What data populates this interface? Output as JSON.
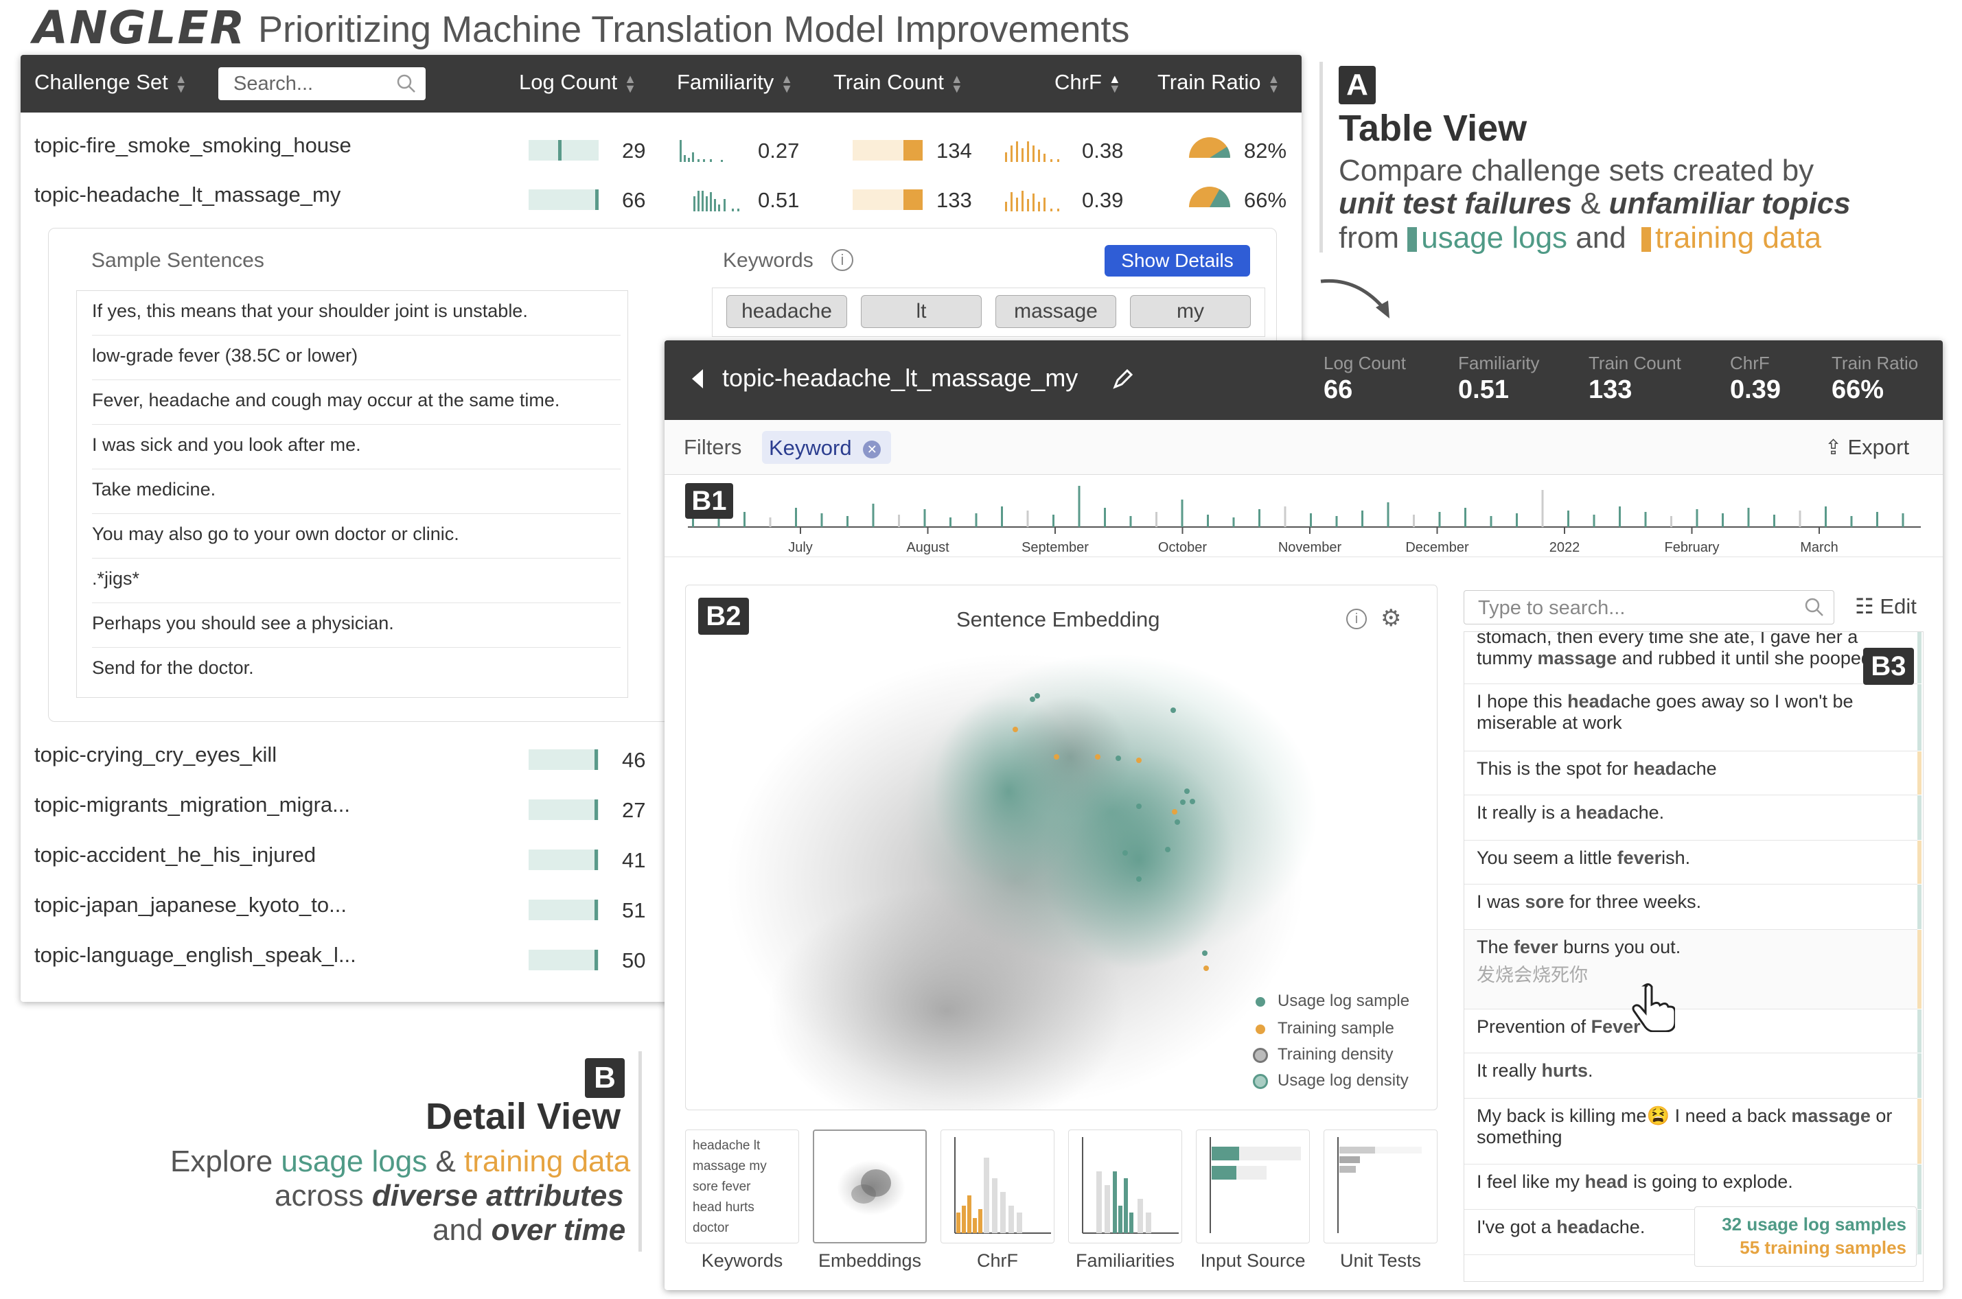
{
  "title": {
    "logo": "ANGLER",
    "subtitle": "Prioritizing Machine Translation Model Improvements"
  },
  "table": {
    "headers": {
      "challenge_set": "Challenge Set",
      "search_placeholder": "Search...",
      "log_count": "Log Count",
      "familiarity": "Familiarity",
      "train_count": "Train Count",
      "chrf": "ChrF",
      "train_ratio": "Train Ratio"
    },
    "rows": [
      {
        "name": "topic-fire_smoke_smoking_house",
        "log_count": "29",
        "log_frac": 0.44,
        "familiarity": "0.27",
        "train_count": "134",
        "chrf": "0.38",
        "train_ratio": "82%",
        "ratio_frac": 0.82
      },
      {
        "name": "topic-headache_lt_massage_my",
        "log_count": "66",
        "log_frac": 1.0,
        "familiarity": "0.51",
        "train_count": "133",
        "chrf": "0.39",
        "train_ratio": "66%",
        "ratio_frac": 0.66
      }
    ],
    "more_rows": [
      {
        "name": "topic-crying_cry_eyes_kill",
        "log_count": "46"
      },
      {
        "name": "topic-migrants_migration_migra...",
        "log_count": "27"
      },
      {
        "name": "topic-accident_he_his_injured",
        "log_count": "41"
      },
      {
        "name": "topic-japan_japanese_kyoto_to...",
        "log_count": "51"
      },
      {
        "name": "topic-language_english_speak_l...",
        "log_count": "50"
      }
    ],
    "expanded": {
      "sample_label": "Sample Sentences",
      "sentences": [
        "If yes, this means that your shoulder joint is unstable.",
        "low-grade fever (38.5C or lower)",
        "Fever, headache and cough may occur at the same time.",
        "I was sick and you look after me.",
        "Take medicine.",
        "You may also go to your own doctor or clinic.",
        ".*jigs*",
        "Perhaps you should see a physician.",
        "Send for the doctor."
      ],
      "keywords_label": "Keywords",
      "show_details": "Show Details",
      "keywords": [
        "headache",
        "lt",
        "massage",
        "my"
      ]
    }
  },
  "annotation_a": {
    "badge": "A",
    "title": "Table View",
    "line1": "Compare challenge sets created by",
    "line2a": "unit test failures",
    "line2b": " & ",
    "line2c": "unfamiliar topics",
    "line3a": "from ",
    "line3b": "usage logs",
    "line3c": " and ",
    "line3d": "training data"
  },
  "annotation_b": {
    "badge": "B",
    "title": "Detail View",
    "line1a": "Explore ",
    "line1b": "usage logs",
    "line1c": " & ",
    "line1d": "training data",
    "line2a": "across ",
    "line2b": "diverse attributes",
    "line3a": "and ",
    "line3b": "over time"
  },
  "detail": {
    "title": "topic-headache_lt_massage_my",
    "stats": [
      {
        "label": "Log Count",
        "value": "66"
      },
      {
        "label": "Familiarity",
        "value": "0.51"
      },
      {
        "label": "Train Count",
        "value": "133"
      },
      {
        "label": "ChrF",
        "value": "0.39"
      },
      {
        "label": "Train Ratio",
        "value": "66%"
      }
    ],
    "filters_label": "Filters",
    "filter_chip": "Keyword",
    "export": "Export",
    "timeline": {
      "badge": "B1",
      "months": [
        "July",
        "August",
        "September",
        "October",
        "November",
        "December",
        "2022",
        "February",
        "March"
      ]
    },
    "embedding": {
      "badge": "B2",
      "title": "Sentence Embedding",
      "legend": [
        "Usage log sample",
        "Training sample",
        "Training density",
        "Usage log density"
      ]
    },
    "thumbs": {
      "labels": [
        "Keywords",
        "Embeddings",
        "ChrF",
        "Familiarities",
        "Input Source",
        "Unit Tests"
      ],
      "keyword_words": [
        "headache",
        "lt",
        "massage",
        "my",
        "sore",
        "fever",
        "head",
        "hurts",
        "doctor"
      ]
    },
    "list": {
      "badge": "B3",
      "search_placeholder": "Type to search...",
      "edit": "Edit",
      "items": [
        {
          "pre": "stomach, then every time she ate, I gave her a tummy ",
          "kw": "massage",
          "post": " and rubbed it until she pooped.",
          "type": "usage"
        },
        {
          "pre": "I hope this ",
          "kw": "head",
          "post": "ache goes away so I won't be miserable at work",
          "type": "usage"
        },
        {
          "pre": "This is the spot for ",
          "kw": "head",
          "post": "ache",
          "type": "training"
        },
        {
          "pre": "It really is a ",
          "kw": "head",
          "post": "ache.",
          "type": "usage"
        },
        {
          "pre": "You seem a little ",
          "kw": "fever",
          "post": "ish.",
          "type": "training"
        },
        {
          "pre": "I was ",
          "kw": "sore",
          "post": " for three weeks.",
          "type": "usage"
        },
        {
          "pre": "The ",
          "kw": "fever",
          "post": " burns you out.",
          "type": "training",
          "translation": "发烧会烧死你"
        },
        {
          "pre": "Prevention of ",
          "kw": "Fever",
          "post": "",
          "type": "usage"
        },
        {
          "pre": "It really ",
          "kw": "hurts",
          "post": ".",
          "type": "usage"
        },
        {
          "pre": "My back is killing me😫 I need a back ",
          "kw": "massage",
          "post": " or something",
          "type": "training"
        },
        {
          "pre": "I feel like my ",
          "kw": "head",
          "post": " is going to explode.",
          "type": "usage"
        },
        {
          "pre": "I've got a ",
          "kw": "head",
          "post": "ache.",
          "type": "usage"
        }
      ],
      "usage_count": "32 usage log samples",
      "training_count": "55 training samples"
    }
  },
  "colors": {
    "usage": "#5a9a8a",
    "training": "#e6a340",
    "header": "#3a3a3a",
    "button": "#2f5dd6"
  }
}
